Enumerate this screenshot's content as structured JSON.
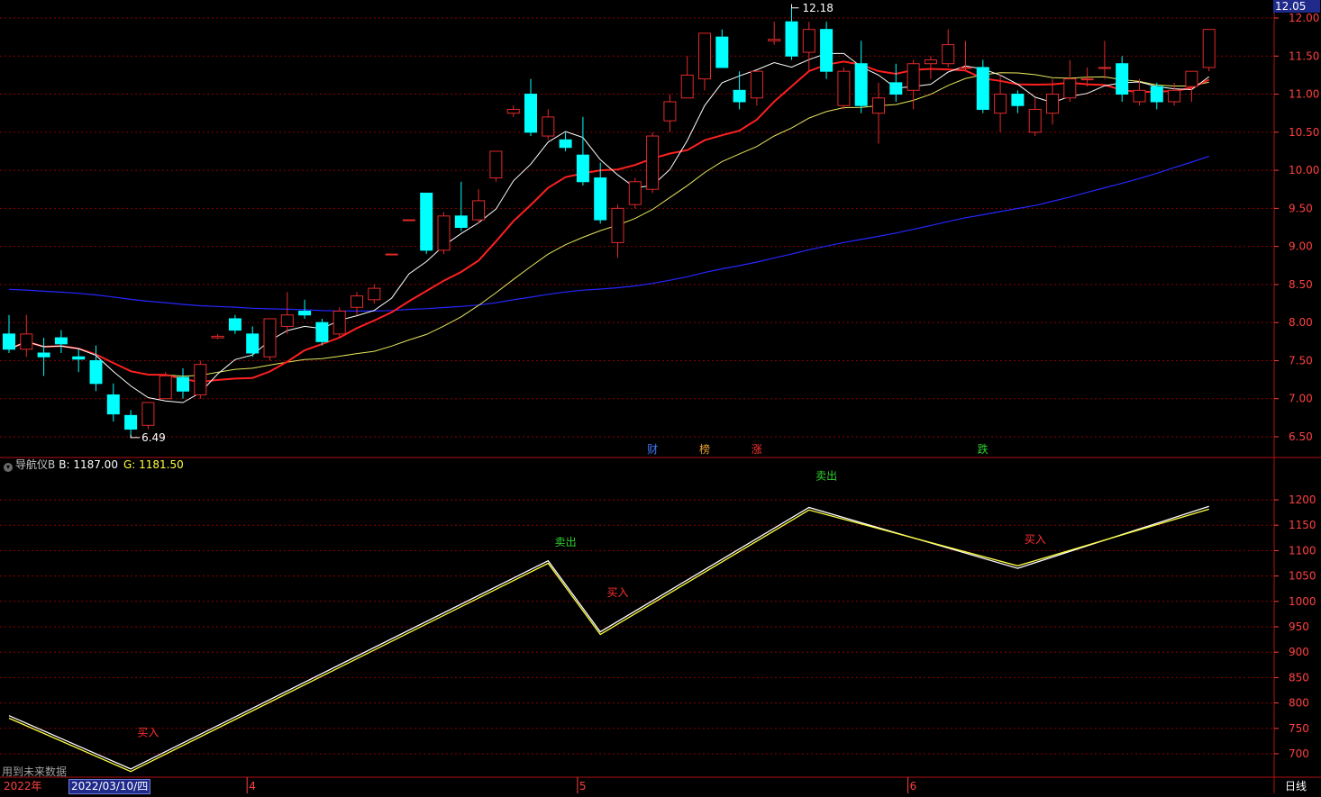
{
  "colors": {
    "up": "#e22a2a",
    "down": "#00ffff",
    "ma5": "#ffffff",
    "ma10": "#ff2020",
    "ma20": "#e6e65c",
    "ma60": "#2626ff",
    "line_b": "#ffffff",
    "line_g": "#ffff40",
    "grid": "#8b0000",
    "axis_text": "#ff4040",
    "buy": "#ff3030",
    "sell": "#30d030"
  },
  "axis": {
    "price_ticks": [
      "12.00",
      "11.50",
      "11.00",
      "10.50",
      "10.00",
      "9.50",
      "9.00",
      "8.50",
      "8.00",
      "7.50",
      "7.00",
      "6.50"
    ],
    "indicator_ticks": [
      "1200",
      "1150",
      "1100",
      "1050",
      "1000",
      "950",
      "900",
      "850",
      "800",
      "750",
      "700"
    ],
    "x_labels": [
      {
        "label": "2022年",
        "index": 0
      },
      {
        "label": "4",
        "index": 14
      },
      {
        "label": "5",
        "index": 33
      },
      {
        "label": "6",
        "index": 52
      }
    ],
    "last_price": "12.05",
    "period": "日线",
    "cursor_date": "2022/03/10/四"
  },
  "indicator": {
    "name": "导航仪B",
    "b_label": "B: 1187.00",
    "g_label": "G: 1181.50",
    "future_note": "用到未来数据"
  },
  "chart_data": [
    {
      "type": "candlestick",
      "title": "",
      "ylim": [
        6.3,
        12.25
      ],
      "price_ticks": [
        12.0,
        11.5,
        11.0,
        10.5,
        10.0,
        9.5,
        9.0,
        8.5,
        8.0,
        7.5,
        7.0,
        6.5
      ],
      "candles": [
        [
          7.85,
          7.65,
          8.1,
          7.6
        ],
        [
          7.65,
          7.85,
          8.1,
          7.55
        ],
        [
          7.6,
          7.55,
          7.8,
          7.3
        ],
        [
          7.8,
          7.72,
          7.9,
          7.6
        ],
        [
          7.55,
          7.52,
          7.65,
          7.35
        ],
        [
          7.5,
          7.2,
          7.7,
          7.1
        ],
        [
          7.05,
          6.8,
          7.2,
          6.7
        ],
        [
          6.78,
          6.6,
          6.85,
          6.49
        ],
        [
          6.65,
          6.95,
          6.95,
          6.6
        ],
        [
          7.0,
          7.3,
          7.35,
          7.0
        ],
        [
          7.28,
          7.1,
          7.4,
          7.0
        ],
        [
          7.05,
          7.45,
          7.5,
          7.0
        ],
        [
          7.8,
          7.82,
          7.85,
          7.78
        ],
        [
          8.05,
          7.9,
          8.1,
          7.85
        ],
        [
          7.85,
          7.6,
          7.95,
          7.55
        ],
        [
          7.55,
          8.05,
          8.05,
          7.5
        ],
        [
          7.95,
          8.1,
          8.4,
          7.85
        ],
        [
          8.15,
          8.1,
          8.3,
          8.05
        ],
        [
          8.0,
          7.75,
          8.05,
          7.7
        ],
        [
          7.85,
          8.15,
          8.2,
          7.8
        ],
        [
          8.2,
          8.35,
          8.4,
          8.1
        ],
        [
          8.3,
          8.45,
          8.5,
          8.25
        ],
        [
          8.9,
          8.9,
          8.9,
          8.9
        ],
        [
          9.35,
          9.35,
          9.35,
          9.35
        ],
        [
          9.7,
          8.95,
          9.7,
          8.9
        ],
        [
          8.95,
          9.4,
          9.45,
          8.9
        ],
        [
          9.4,
          9.25,
          9.85,
          9.2
        ],
        [
          9.35,
          9.6,
          9.75,
          9.3
        ],
        [
          9.9,
          10.25,
          10.25,
          9.85
        ],
        [
          10.75,
          10.8,
          10.85,
          10.7
        ],
        [
          11.0,
          10.5,
          11.2,
          10.45
        ],
        [
          10.45,
          10.7,
          10.8,
          10.4
        ],
        [
          10.4,
          10.3,
          10.5,
          10.25
        ],
        [
          10.2,
          9.85,
          10.7,
          9.8
        ],
        [
          9.9,
          9.35,
          10.1,
          9.3
        ],
        [
          9.05,
          9.5,
          9.55,
          8.85
        ],
        [
          9.55,
          9.85,
          9.9,
          9.5
        ],
        [
          9.75,
          10.45,
          10.5,
          9.7
        ],
        [
          10.65,
          10.9,
          11.0,
          10.5
        ],
        [
          10.95,
          11.25,
          11.5,
          10.95
        ],
        [
          11.2,
          11.8,
          11.8,
          11.05
        ],
        [
          11.75,
          11.35,
          11.85,
          11.35
        ],
        [
          11.05,
          10.9,
          11.3,
          10.8
        ],
        [
          10.95,
          11.3,
          11.3,
          10.85
        ],
        [
          11.7,
          11.72,
          11.95,
          11.65
        ],
        [
          11.95,
          11.5,
          12.18,
          11.45
        ],
        [
          11.55,
          11.85,
          11.95,
          11.3
        ],
        [
          11.85,
          11.3,
          11.95,
          11.2
        ],
        [
          10.85,
          11.3,
          11.35,
          10.8
        ],
        [
          11.4,
          10.85,
          11.7,
          10.75
        ],
        [
          10.75,
          10.95,
          11.15,
          10.35
        ],
        [
          11.15,
          11.0,
          11.4,
          10.9
        ],
        [
          11.05,
          11.4,
          11.45,
          10.8
        ],
        [
          11.4,
          11.45,
          11.5,
          11.2
        ],
        [
          11.4,
          11.65,
          11.85,
          11.35
        ],
        [
          11.35,
          11.35,
          11.7,
          11.3
        ],
        [
          11.35,
          10.8,
          11.45,
          10.75
        ],
        [
          10.75,
          11.0,
          11.25,
          10.5
        ],
        [
          11.0,
          10.85,
          11.05,
          10.75
        ],
        [
          10.5,
          10.8,
          10.95,
          10.45
        ],
        [
          10.75,
          11.0,
          11.2,
          10.6
        ],
        [
          10.95,
          11.2,
          11.45,
          10.9
        ],
        [
          11.2,
          11.2,
          11.35,
          11.1
        ],
        [
          11.35,
          11.35,
          11.7,
          11.2
        ],
        [
          11.4,
          11.0,
          11.5,
          10.9
        ],
        [
          10.9,
          11.05,
          11.2,
          10.85
        ],
        [
          11.1,
          10.9,
          11.15,
          10.8
        ],
        [
          10.9,
          11.05,
          11.15,
          10.85
        ],
        [
          11.1,
          11.3,
          11.3,
          10.9
        ],
        [
          11.35,
          11.85,
          11.85,
          11.3
        ]
      ],
      "annotations": [
        {
          "text": "12.18",
          "index": 45,
          "price": 12.18,
          "pos": "above"
        },
        {
          "text": "6.49",
          "index": 7,
          "price": 6.49,
          "pos": "below"
        }
      ],
      "event_markers": [
        {
          "text": "财",
          "index": 37,
          "color": "#3f7bff"
        },
        {
          "text": "榜",
          "index": 40,
          "color": "#e8a030"
        },
        {
          "text": "涨",
          "index": 43,
          "color": "#ff3030"
        },
        {
          "text": "跌",
          "index": 56,
          "color": "#30d030"
        }
      ]
    },
    {
      "type": "line",
      "title": "",
      "ylim": [
        660,
        1255
      ],
      "ticks": [
        1200,
        1150,
        1100,
        1050,
        1000,
        950,
        900,
        850,
        800,
        750,
        700
      ],
      "series": [
        {
          "name": "B",
          "points": [
            [
              0,
              775
            ],
            [
              7,
              670
            ],
            [
              31,
              1080
            ],
            [
              34,
              940
            ],
            [
              46,
              1185
            ],
            [
              58,
              1065
            ],
            [
              69,
              1187
            ]
          ]
        },
        {
          "name": "G",
          "points": [
            [
              0,
              770
            ],
            [
              7,
              665
            ],
            [
              31,
              1075
            ],
            [
              34,
              935
            ],
            [
              46,
              1180
            ],
            [
              58,
              1070
            ],
            [
              69,
              1181.5
            ]
          ]
        }
      ],
      "signals": [
        {
          "text": "买入",
          "index": 8,
          "value": 735,
          "type": "buy"
        },
        {
          "text": "卖出",
          "index": 32,
          "value": 1110,
          "type": "sell"
        },
        {
          "text": "买入",
          "index": 35,
          "value": 1010,
          "type": "buy"
        },
        {
          "text": "卖出",
          "index": 47,
          "value": 1240,
          "type": "sell"
        },
        {
          "text": "买入",
          "index": 59,
          "value": 1115,
          "type": "buy"
        }
      ]
    }
  ]
}
